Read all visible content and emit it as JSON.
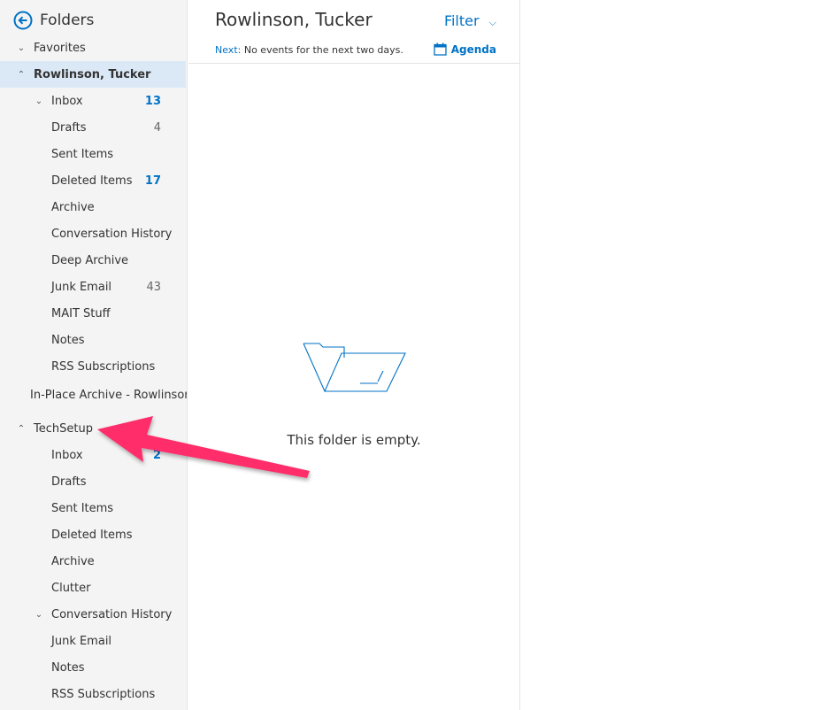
{
  "sidebar": {
    "title": "Folders",
    "favorites": "Favorites",
    "account": "Rowlinson, Tucker",
    "account_folders": [
      {
        "label": "Inbox",
        "count": "13",
        "count_style": "blue",
        "chevron": "down"
      },
      {
        "label": "Drafts",
        "count": "4",
        "count_style": "gray"
      },
      {
        "label": "Sent Items"
      },
      {
        "label": "Deleted Items",
        "count": "17",
        "count_style": "blue"
      },
      {
        "label": "Archive"
      },
      {
        "label": "Conversation History"
      },
      {
        "label": "Deep Archive"
      },
      {
        "label": "Junk Email",
        "count": "43",
        "count_style": "gray"
      },
      {
        "label": "MAIT Stuff"
      },
      {
        "label": "Notes"
      },
      {
        "label": "RSS Subscriptions"
      }
    ],
    "archive": "In-Place Archive - Rowlinson, Tucker",
    "group": "TechSetup",
    "group_folders": [
      {
        "label": "Inbox",
        "count": "2",
        "count_style": "blue"
      },
      {
        "label": "Drafts"
      },
      {
        "label": "Sent Items"
      },
      {
        "label": "Deleted Items"
      },
      {
        "label": "Archive"
      },
      {
        "label": "Clutter"
      },
      {
        "label": "Conversation History",
        "chevron": "down"
      },
      {
        "label": "Junk Email"
      },
      {
        "label": "Notes"
      },
      {
        "label": "RSS Subscriptions"
      }
    ]
  },
  "main": {
    "title": "Rowlinson, Tucker",
    "filter": "Filter",
    "next_label": "Next:",
    "next_text": "No events for the next two days.",
    "agenda": "Agenda",
    "empty": "This folder is empty."
  },
  "colors": {
    "accent": "#0072c6",
    "annotation_arrow": "#ff2d6a",
    "selected": "#dbe9f7"
  }
}
